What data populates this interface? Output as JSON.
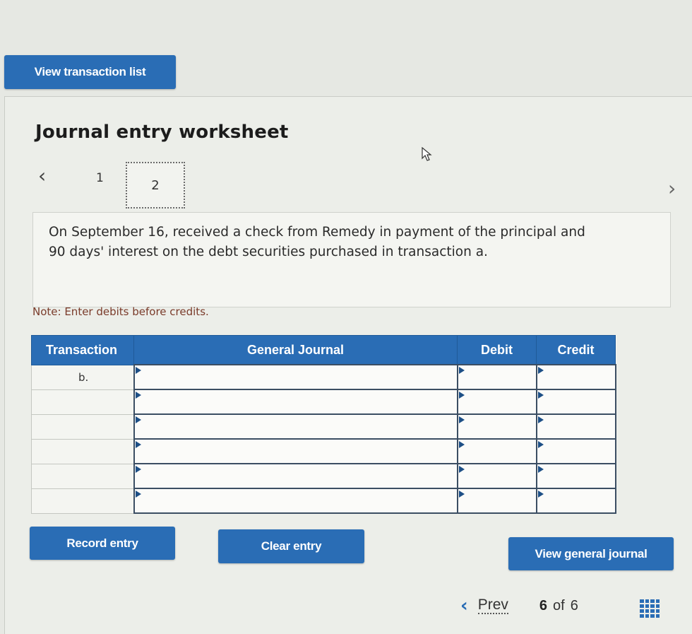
{
  "top": {
    "view_transaction_list": "View transaction list"
  },
  "worksheet": {
    "title": "Journal entry worksheet",
    "pages": [
      "1",
      "2"
    ],
    "active_page": "2",
    "description": "On September 16, received a check from Remedy in payment of the principal and 90 days' interest on the debt securities purchased in transaction a.",
    "note": "Note: Enter debits before credits."
  },
  "table": {
    "headers": {
      "transaction": "Transaction",
      "general_journal": "General Journal",
      "debit": "Debit",
      "credit": "Credit"
    },
    "rows": [
      {
        "transaction": "b.",
        "account": "",
        "debit": "",
        "credit": ""
      },
      {
        "transaction": "",
        "account": "",
        "debit": "",
        "credit": ""
      },
      {
        "transaction": "",
        "account": "",
        "debit": "",
        "credit": ""
      },
      {
        "transaction": "",
        "account": "",
        "debit": "",
        "credit": ""
      },
      {
        "transaction": "",
        "account": "",
        "debit": "",
        "credit": ""
      },
      {
        "transaction": "",
        "account": "",
        "debit": "",
        "credit": ""
      }
    ]
  },
  "actions": {
    "record_entry": "Record entry",
    "clear_entry": "Clear entry",
    "view_general_journal": "View general journal"
  },
  "footer": {
    "prev": "Prev",
    "current_page": "6",
    "of": "of",
    "total_pages": "6"
  },
  "colors": {
    "accent": "#2a6db5",
    "note": "#7a3b2a"
  }
}
